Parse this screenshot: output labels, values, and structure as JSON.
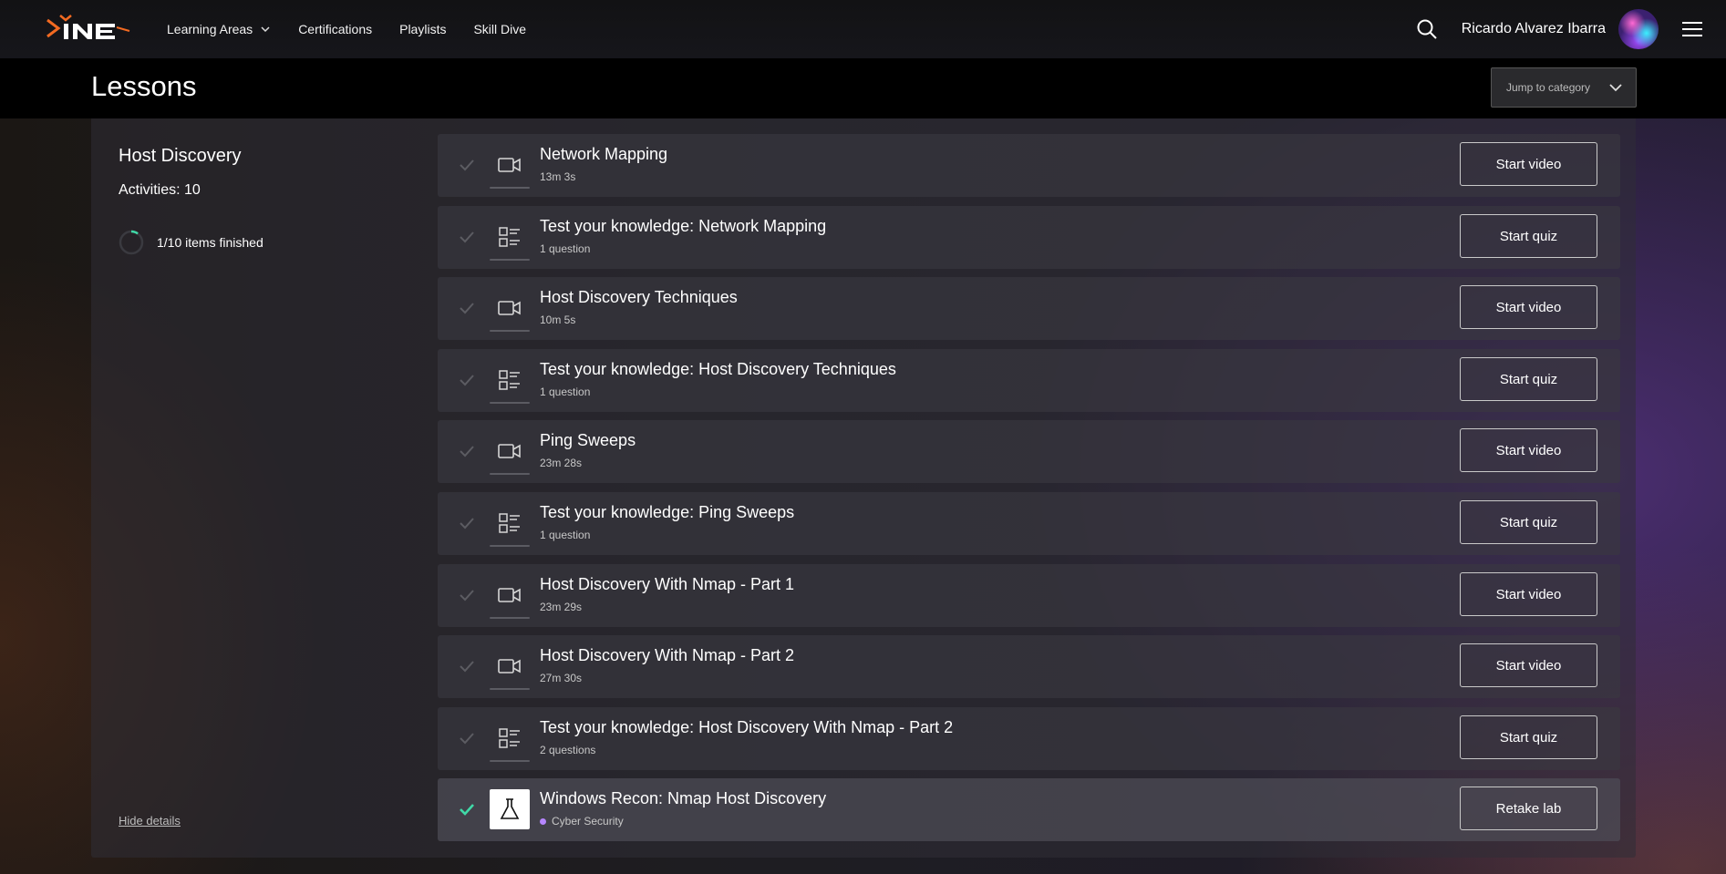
{
  "nav": {
    "logo_text": "iNE",
    "links": [
      {
        "label": "Learning Areas",
        "has_dropdown": true
      },
      {
        "label": "Certifications"
      },
      {
        "label": "Playlists"
      },
      {
        "label": "Skill Dive"
      }
    ],
    "user_name": "Ricardo Alvarez Ibarra",
    "icons": {
      "search": "search-icon",
      "menu": "hamburger-menu-icon",
      "dropdown": "chevron-down-icon"
    }
  },
  "header": {
    "title": "Lessons",
    "jump_placeholder": "Jump to category"
  },
  "section": {
    "title": "Host Discovery",
    "activities": "Activities: 10",
    "progress_text": "1/10 items finished",
    "progress_fraction": 0.1,
    "hide_details": "Hide details"
  },
  "colors": {
    "accent_check": "#40d9a8",
    "lab_dot": "#b686ff"
  },
  "lessons": [
    {
      "type": "video",
      "title": "Network Mapping",
      "meta": "13m 3s",
      "button": "Start video",
      "completed": false
    },
    {
      "type": "quiz",
      "title": "Test your knowledge: Network Mapping",
      "meta": "1 question",
      "button": "Start quiz",
      "completed": false
    },
    {
      "type": "video",
      "title": "Host Discovery Techniques",
      "meta": "10m 5s",
      "button": "Start video",
      "completed": false
    },
    {
      "type": "quiz",
      "title": "Test your knowledge: Host Discovery Techniques",
      "meta": "1 question",
      "button": "Start quiz",
      "completed": false
    },
    {
      "type": "video",
      "title": "Ping Sweeps",
      "meta": "23m 28s",
      "button": "Start video",
      "completed": false
    },
    {
      "type": "quiz",
      "title": "Test your knowledge: Ping Sweeps",
      "meta": "1 question",
      "button": "Start quiz",
      "completed": false
    },
    {
      "type": "video",
      "title": "Host Discovery With Nmap - Part 1",
      "meta": "23m 29s",
      "button": "Start video",
      "completed": false
    },
    {
      "type": "video",
      "title": "Host Discovery With Nmap - Part 2",
      "meta": "27m 30s",
      "button": "Start video",
      "completed": false
    },
    {
      "type": "quiz",
      "title": "Test your knowledge: Host Discovery With Nmap - Part 2",
      "meta": "2 questions",
      "button": "Start quiz",
      "completed": false
    },
    {
      "type": "lab",
      "title": "Windows Recon: Nmap Host Discovery",
      "meta": "Cyber Security",
      "button": "Retake lab",
      "completed": true
    }
  ]
}
